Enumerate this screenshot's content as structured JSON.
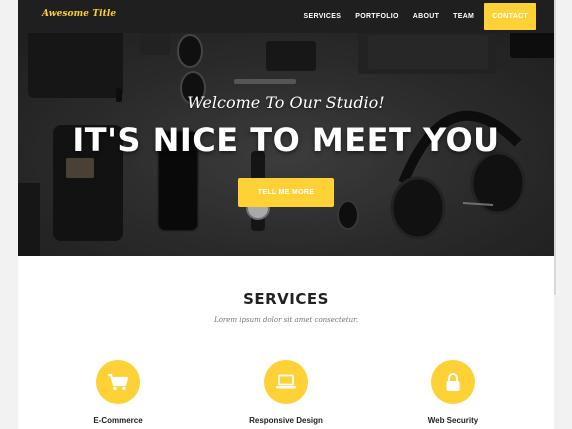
{
  "brand": "Awesome Title",
  "nav": {
    "links": [
      "SERVICES",
      "PORTFOLIO",
      "ABOUT",
      "TEAM"
    ],
    "cta": "CONTACT"
  },
  "hero": {
    "subheading": "Welcome To Our Studio!",
    "heading": "IT'S NICE TO MEET YOU",
    "button": "TELL ME MORE"
  },
  "services": {
    "title": "SERVICES",
    "subtitle": "Lorem ipsum dolor sit amet consectetur.",
    "items": [
      {
        "label": "E-Commerce",
        "icon": "shopping-cart-icon"
      },
      {
        "label": "Responsive Design",
        "icon": "laptop-icon"
      },
      {
        "label": "Web Security",
        "icon": "lock-icon"
      }
    ]
  },
  "colors": {
    "accent": "#fed136",
    "nav_bg": "#1f1f1f",
    "text_dark": "#222222"
  }
}
